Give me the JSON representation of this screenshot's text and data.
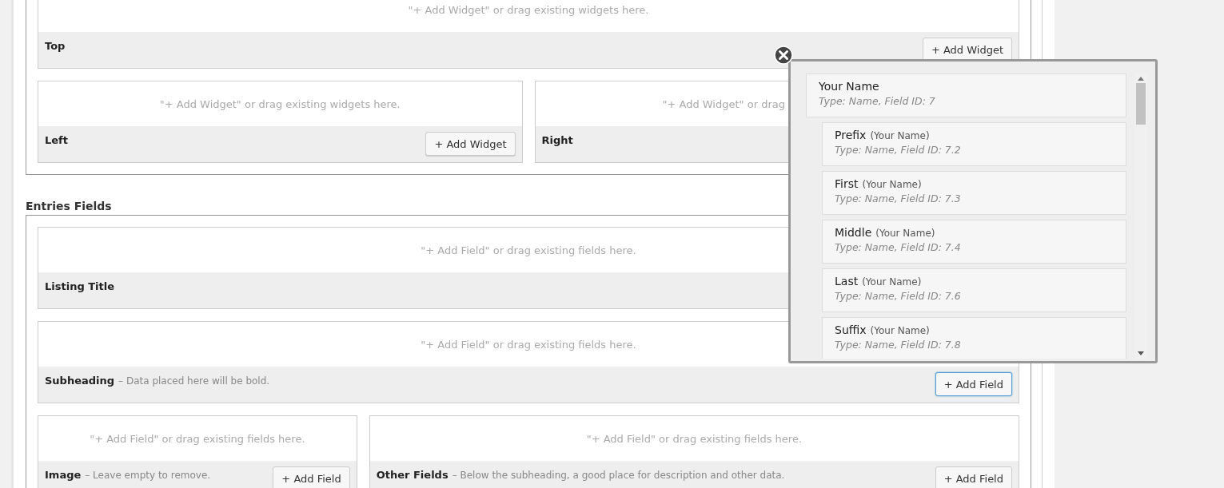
{
  "widgets_section": {
    "rows": [
      [
        {
          "label": "Top",
          "drop_text": "\"+ Add Widget\" or drag existing widgets here.",
          "button": {
            "label": "+ Add Widget",
            "focused": false
          }
        }
      ],
      [
        {
          "label": "Left",
          "drop_text": "\"+ Add Widget\" or drag existing widgets here.",
          "button": {
            "label": "+ Add Widget",
            "focused": false
          }
        },
        {
          "label": "Right",
          "drop_text": "\"+ Add Widget\" or drag",
          "partial": true
        }
      ]
    ]
  },
  "entries_section": {
    "title": "Entries Fields",
    "rows": [
      [
        {
          "label": "Listing Title",
          "drop_text": "\"+ Add Field\" or drag existing fields here."
        }
      ],
      [
        {
          "label": "Subheading",
          "hint": "– Data placed here will be bold.",
          "drop_text": "\"+ Add Field\" or drag existing fields here.",
          "button": {
            "label": "+ Add Field",
            "focused": true
          }
        }
      ],
      [
        {
          "label": "Image",
          "hint": "– Leave empty to remove.",
          "drop_text": "\"+ Add Field\" or drag existing fields here.",
          "button": {
            "label": "+ Add Field",
            "focused": false
          }
        },
        {
          "label": "Other Fields",
          "hint": "– Below the subheading, a good place for description and other data.",
          "drop_text": "\"+ Add Field\" or drag existing fields here.",
          "button": {
            "label": "+ Add Field",
            "focused": false
          }
        }
      ]
    ]
  },
  "field_picker": {
    "fields": [
      {
        "name": "Your Name",
        "type_line": "Type: Name, Field ID: 7",
        "children": [
          {
            "name": "Prefix",
            "parent": "(Your Name)",
            "type_line": "Type: Name, Field ID: 7.2"
          },
          {
            "name": "First",
            "parent": "(Your Name)",
            "type_line": "Type: Name, Field ID: 7.3"
          },
          {
            "name": "Middle",
            "parent": "(Your Name)",
            "type_line": "Type: Name, Field ID: 7.4"
          },
          {
            "name": "Last",
            "parent": "(Your Name)",
            "type_line": "Type: Name, Field ID: 7.6"
          },
          {
            "name": "Suffix",
            "parent": "(Your Name)",
            "type_line": "Type: Name, Field ID: 7.8"
          }
        ]
      }
    ]
  }
}
